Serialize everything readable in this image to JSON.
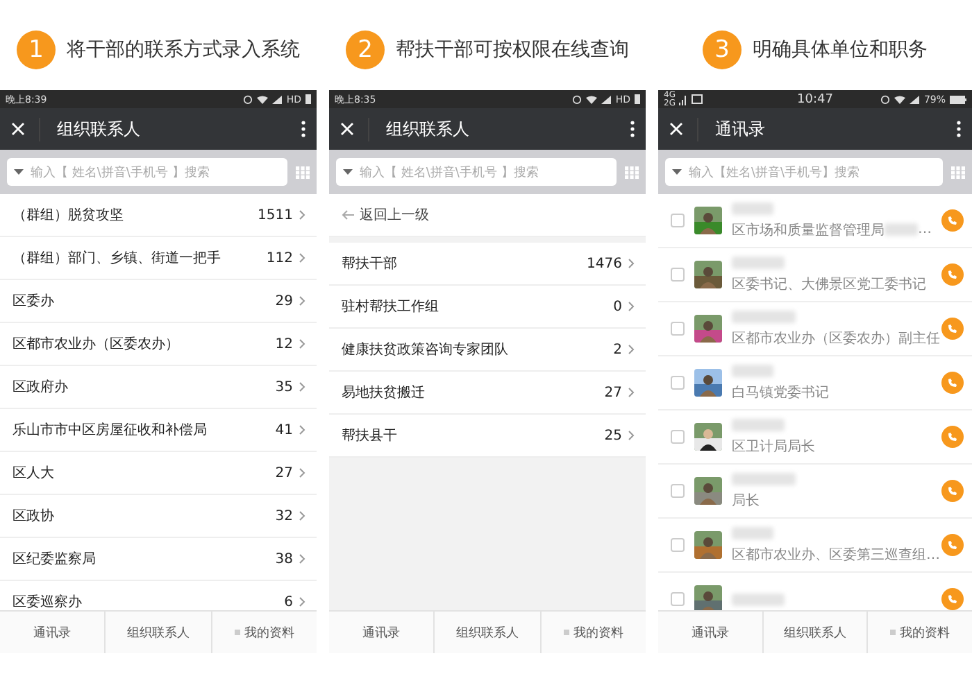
{
  "panels": [
    {
      "step": "1",
      "caption": "将干部的联系方式录入系统",
      "status_bar": {
        "kind": "android",
        "time": "晚上8:39",
        "network": "HD"
      },
      "title": "组织联系人",
      "search_placeholder": "输入【 姓名\\拼音\\手机号 】搜索",
      "view": {
        "kind": "groups",
        "items": [
          {
            "name": "（群组）脱贫攻坚",
            "count": "1511"
          },
          {
            "name": "（群组）部门、乡镇、街道一把手",
            "count": "112"
          },
          {
            "name": "区委办",
            "count": "29"
          },
          {
            "name": "区都市农业办（区委农办）",
            "count": "12"
          },
          {
            "name": "区政府办",
            "count": "35"
          },
          {
            "name": "乐山市市中区房屋征收和补偿局",
            "count": "41"
          },
          {
            "name": "区人大",
            "count": "27"
          },
          {
            "name": "区政协",
            "count": "32"
          },
          {
            "name": "区纪委监察局",
            "count": "38"
          },
          {
            "name": "区委巡察办",
            "count": "6"
          }
        ]
      },
      "tabs": [
        {
          "label": "通讯录",
          "has_icon": false
        },
        {
          "label": "组织联系人",
          "has_icon": false
        },
        {
          "label": "我的资料",
          "has_icon": true
        }
      ]
    },
    {
      "step": "2",
      "caption": "帮扶干部可按权限在线查询",
      "status_bar": {
        "kind": "android",
        "time": "晚上8:35",
        "network": "HD"
      },
      "title": "组织联系人",
      "search_placeholder": "输入【 姓名\\拼音\\手机号 】搜索",
      "view": {
        "kind": "groups",
        "back": "返回上一级",
        "items": [
          {
            "name": "帮扶干部",
            "count": "1476"
          },
          {
            "name": "驻村帮扶工作组",
            "count": "0"
          },
          {
            "name": "健康扶贫政策咨询专家团队",
            "count": "2"
          },
          {
            "name": "易地扶贫搬迁",
            "count": "27"
          },
          {
            "name": "帮扶县干",
            "count": "25"
          }
        ]
      },
      "tabs": [
        {
          "label": "通讯录",
          "has_icon": false
        },
        {
          "label": "组织联系人",
          "has_icon": false
        },
        {
          "label": "我的资料",
          "has_icon": true
        }
      ]
    },
    {
      "step": "3",
      "caption": "明确具体单位和职务",
      "status_bar": {
        "kind": "centered",
        "time": "10:47",
        "network_top": "4G",
        "network_bottom": "2G",
        "battery": "79%"
      },
      "title": "通讯录",
      "search_placeholder": "输入【姓名\\拼音\\手机号】搜索",
      "view": {
        "kind": "contacts",
        "items": [
          {
            "subtitle": "区市场和质量监督管理局",
            "ellipsis": "…",
            "checked": false
          },
          {
            "subtitle": "区委书记、大佛景区党工委书记",
            "checked": false
          },
          {
            "subtitle": "区都市农业办（区委农办）副主任",
            "checked": false
          },
          {
            "subtitle": "白马镇党委书记",
            "checked": false
          },
          {
            "subtitle": "区卫计局局长",
            "checked": false
          },
          {
            "subtitle": "局长",
            "checked": false
          },
          {
            "subtitle": "区都市农业办、区委第三巡查组…",
            "checked": false
          },
          {
            "checked": false
          }
        ]
      },
      "tabs": [
        {
          "label": "通讯录",
          "has_icon": false
        },
        {
          "label": "组织联系人",
          "has_icon": false
        },
        {
          "label": "我的资料",
          "has_icon": true
        }
      ]
    }
  ]
}
